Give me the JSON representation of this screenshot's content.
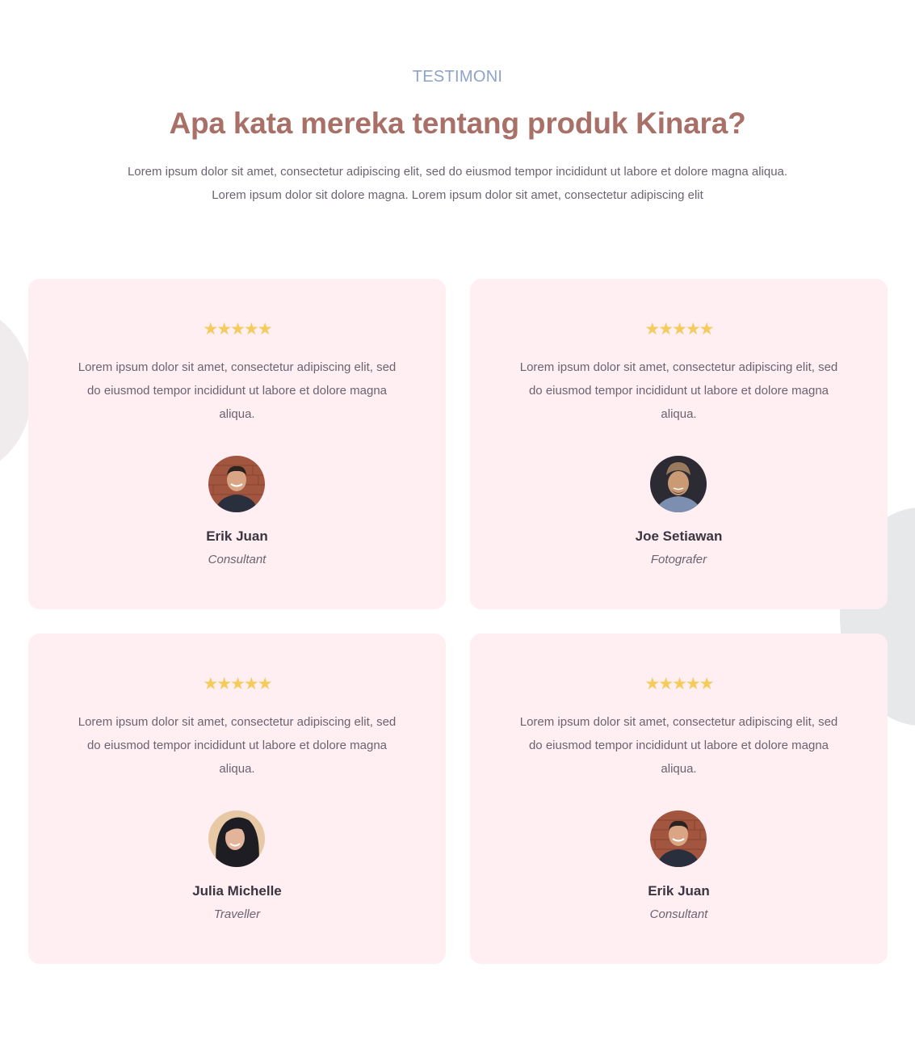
{
  "section": {
    "eyebrow": "TESTIMONI",
    "title": "Apa kata mereka tentang produk Kinara?",
    "description": "Lorem ipsum dolor sit amet, consectetur adipiscing elit, sed do eiusmod tempor incididunt ut labore et dolore magna aliqua. Lorem ipsum dolor sit dolore magna. Lorem ipsum dolor sit amet, consectetur adipiscing elit"
  },
  "colors": {
    "eyebrow": "#8ea3c8",
    "title": "#a97068",
    "card_bg": "#ffeef2",
    "star": "#f5cb5c",
    "body_text": "#6b6470"
  },
  "testimonials": [
    {
      "rating": 5,
      "stars": "★★★★★",
      "quote": "Lorem ipsum dolor sit amet, consectetur adipiscing elit, sed do eiusmod tempor incididunt ut labore et dolore magna aliqua.",
      "name": "Erik Juan",
      "role": "Consultant",
      "avatar_icon": "avatar-man-brick-wall"
    },
    {
      "rating": 5,
      "stars": "★★★★★",
      "quote": "Lorem ipsum dolor sit amet, consectetur adipiscing elit, sed do eiusmod tempor incididunt ut labore et dolore magna aliqua.",
      "name": "Joe Setiawan",
      "role": "Fotografer",
      "avatar_icon": "avatar-man-cap"
    },
    {
      "rating": 5,
      "stars": "★★★★★",
      "quote": "Lorem ipsum dolor sit amet, consectetur adipiscing elit, sed do eiusmod tempor incididunt ut labore et dolore magna aliqua.",
      "name": "Julia Michelle",
      "role": "Traveller",
      "avatar_icon": "avatar-woman-dark-hair"
    },
    {
      "rating": 5,
      "stars": "★★★★★",
      "quote": "Lorem ipsum dolor sit amet, consectetur adipiscing elit, sed do eiusmod tempor incididunt ut labore et dolore magna aliqua.",
      "name": "Erik Juan",
      "role": "Consultant",
      "avatar_icon": "avatar-man-brick-wall"
    }
  ]
}
